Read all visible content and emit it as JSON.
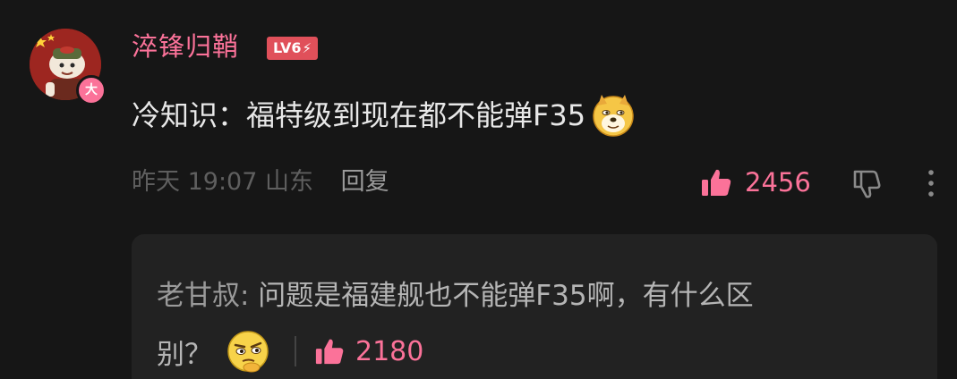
{
  "comment": {
    "username": "淬锋归鞘",
    "level": "LV6",
    "vip_badge": "大",
    "text": "冷知识：福特级到现在都不能弹F35",
    "emoji_icon": "doge-icon",
    "time": "昨天 19:07",
    "location": "山东",
    "reply_label": "回复",
    "likes": "2456"
  },
  "reply": {
    "author": "老甘叔:",
    "text_line1": " 问题是福建舰也不能弹F35啊，有什么区",
    "text_line2": "别？",
    "emoji_icon": "thinking-face-icon",
    "likes": "2180"
  },
  "colors": {
    "background": "#161616",
    "accent_pink": "#fb7299",
    "level_red": "#e0505a",
    "reply_box": "#222222",
    "text_primary": "#e8e8e8",
    "text_meta": "#5f5f5f"
  }
}
